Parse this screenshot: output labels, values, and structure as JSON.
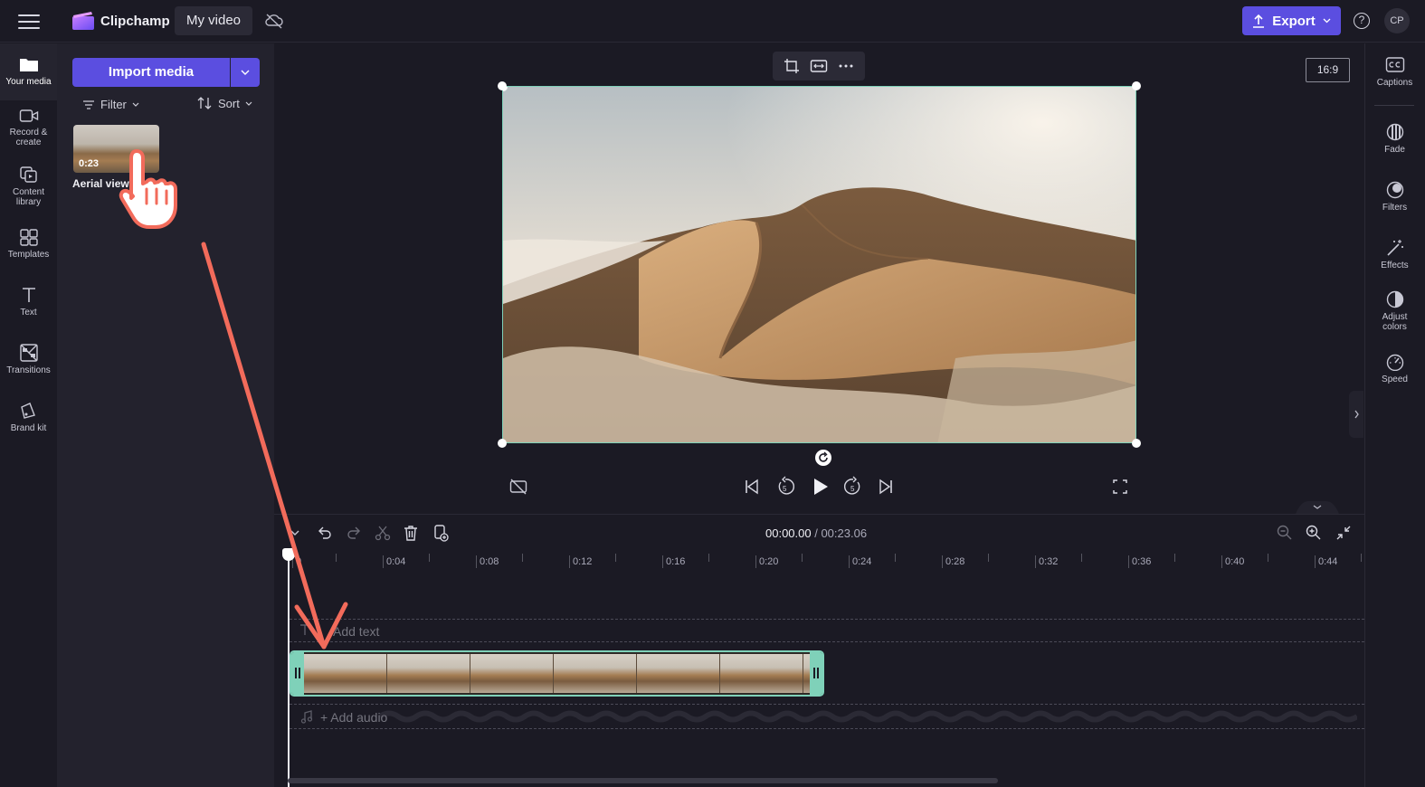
{
  "header": {
    "brand": "Clipchamp",
    "project_title": "My video",
    "export_label": "Export",
    "help_glyph": "?",
    "avatar_initials": "CP"
  },
  "left_nav": [
    {
      "label": "Your media",
      "icon": "folder-icon"
    },
    {
      "label": "Record & create",
      "icon": "camera-icon"
    },
    {
      "label": "Content library",
      "icon": "library-icon"
    },
    {
      "label": "Templates",
      "icon": "templates-icon"
    },
    {
      "label": "Text",
      "icon": "text-icon"
    },
    {
      "label": "Transitions",
      "icon": "transitions-icon"
    },
    {
      "label": "Brand kit",
      "icon": "brand-kit-icon"
    }
  ],
  "media_panel": {
    "import_label": "Import media",
    "filter_label": "Filter",
    "sort_label": "Sort",
    "items": [
      {
        "name": "Aerial view of",
        "duration": "0:23"
      }
    ]
  },
  "preview": {
    "aspect_ratio": "16:9"
  },
  "timeline": {
    "current_time": "00:00.00",
    "separator": " / ",
    "total_time": "00:23.06",
    "ruler": [
      "0",
      "0:04",
      "0:08",
      "0:12",
      "0:16",
      "0:20",
      "0:24",
      "0:28",
      "0:32",
      "0:36",
      "0:40",
      "0:44"
    ],
    "add_text_label": "Add text",
    "add_audio_label": "+ Add audio"
  },
  "right_nav": [
    {
      "label": "Captions",
      "icon": "captions-icon"
    },
    {
      "label": "Fade",
      "icon": "fade-icon"
    },
    {
      "label": "Filters",
      "icon": "filters-icon"
    },
    {
      "label": "Effects",
      "icon": "effects-icon"
    },
    {
      "label": "Adjust colors",
      "icon": "adjust-colors-icon"
    },
    {
      "label": "Speed",
      "icon": "speed-icon"
    }
  ],
  "colors": {
    "accent": "#5b4ee0",
    "selection": "#7fd1b9",
    "annotation_arrow": "#f26b5b"
  }
}
